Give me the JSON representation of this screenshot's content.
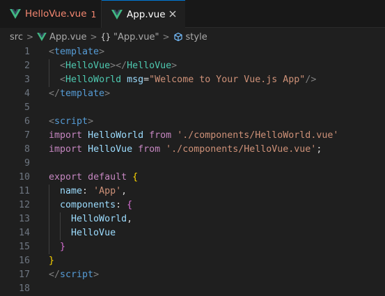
{
  "tabs": [
    {
      "label": "HelloVue.vue",
      "problems": "1"
    },
    {
      "label": "App.vue"
    }
  ],
  "breadcrumb": {
    "folder": "src",
    "file": "App.vue",
    "symbol": "\"App.vue\"",
    "section": "style"
  },
  "editor": {
    "line_numbers": [
      "1",
      "2",
      "3",
      "4",
      "5",
      "6",
      "7",
      "8",
      "9",
      "10",
      "11",
      "12",
      "13",
      "14",
      "15",
      "16",
      "17",
      "18"
    ],
    "lines": [
      [
        {
          "t": "<",
          "c": "punc"
        },
        {
          "t": "template",
          "c": "tag"
        },
        {
          "t": ">",
          "c": "punc"
        }
      ],
      [
        {
          "t": "  "
        },
        {
          "t": "<",
          "c": "punc"
        },
        {
          "t": "HelloVue",
          "c": "comp"
        },
        {
          "t": "></",
          "c": "punc"
        },
        {
          "t": "HelloVue",
          "c": "comp"
        },
        {
          "t": ">",
          "c": "punc"
        }
      ],
      [
        {
          "t": "  "
        },
        {
          "t": "<",
          "c": "punc"
        },
        {
          "t": "HelloWorld",
          "c": "comp"
        },
        {
          "t": " "
        },
        {
          "t": "msg",
          "c": "attr"
        },
        {
          "t": "=",
          "c": "plain"
        },
        {
          "t": "\"Welcome to Your Vue.js App\"",
          "c": "str"
        },
        {
          "t": "/>",
          "c": "punc"
        }
      ],
      [
        {
          "t": "</",
          "c": "punc"
        },
        {
          "t": "template",
          "c": "tag"
        },
        {
          "t": ">",
          "c": "punc"
        }
      ],
      [],
      [
        {
          "t": "<",
          "c": "punc"
        },
        {
          "t": "script",
          "c": "tag"
        },
        {
          "t": ">",
          "c": "punc"
        }
      ],
      [
        {
          "t": "import",
          "c": "kw"
        },
        {
          "t": " "
        },
        {
          "t": "HelloWorld",
          "c": "var"
        },
        {
          "t": " "
        },
        {
          "t": "from",
          "c": "kw"
        },
        {
          "t": " "
        },
        {
          "t": "'./components/HelloWorld.vue'",
          "c": "str"
        }
      ],
      [
        {
          "t": "import",
          "c": "kw"
        },
        {
          "t": " "
        },
        {
          "t": "HelloVue",
          "c": "var"
        },
        {
          "t": " "
        },
        {
          "t": "from",
          "c": "kw"
        },
        {
          "t": " "
        },
        {
          "t": "'./components/HelloVue.vue'",
          "c": "str"
        },
        {
          "t": ";",
          "c": "plain"
        }
      ],
      [],
      [
        {
          "t": "export",
          "c": "kw"
        },
        {
          "t": " "
        },
        {
          "t": "default",
          "c": "kw"
        },
        {
          "t": " "
        },
        {
          "t": "{",
          "c": "brace1"
        }
      ],
      [
        {
          "t": "  "
        },
        {
          "t": "name",
          "c": "var"
        },
        {
          "t": ": ",
          "c": "plain"
        },
        {
          "t": "'App'",
          "c": "str"
        },
        {
          "t": ",",
          "c": "plain"
        }
      ],
      [
        {
          "t": "  "
        },
        {
          "t": "components",
          "c": "var"
        },
        {
          "t": ": ",
          "c": "plain"
        },
        {
          "t": "{",
          "c": "brace2"
        }
      ],
      [
        {
          "t": "    "
        },
        {
          "t": "HelloWorld",
          "c": "var"
        },
        {
          "t": ",",
          "c": "plain"
        }
      ],
      [
        {
          "t": "    "
        },
        {
          "t": "HelloVue",
          "c": "var"
        }
      ],
      [
        {
          "t": "  "
        },
        {
          "t": "}",
          "c": "brace2"
        }
      ],
      [
        {
          "t": "}",
          "c": "brace1"
        }
      ],
      [
        {
          "t": "</",
          "c": "punc"
        },
        {
          "t": "script",
          "c": "tag"
        },
        {
          "t": ">",
          "c": "punc"
        }
      ],
      []
    ]
  },
  "colors": {
    "vue_green": "#41b883",
    "error_tab": "#f48771",
    "active_tab_border": "#0078d4"
  },
  "icons": [
    "vue-icon",
    "close-icon",
    "chevron-right-icon",
    "braces-icon",
    "cube-icon"
  ]
}
